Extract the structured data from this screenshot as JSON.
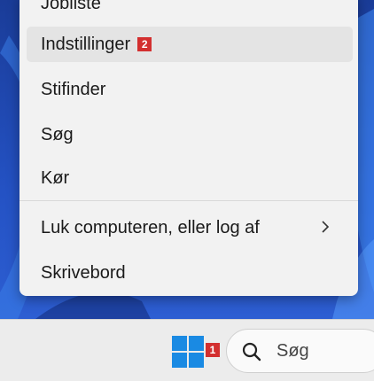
{
  "menu": {
    "items": [
      {
        "label": "Jobliste"
      },
      {
        "label": "Indstillinger",
        "badge": "2"
      },
      {
        "label": "Stifinder"
      },
      {
        "label": "Søg"
      },
      {
        "label": "Kør"
      },
      {
        "label": "Luk computeren, eller log af",
        "submenu_icon": "chevron-right-icon"
      },
      {
        "label": "Skrivebord"
      }
    ]
  },
  "taskbar": {
    "start_badge": "1",
    "search_placeholder": "Søg"
  },
  "colors": {
    "accent": "#1a8ae3",
    "badge": "#d32f2f",
    "menu_bg": "#f2f2f2"
  }
}
